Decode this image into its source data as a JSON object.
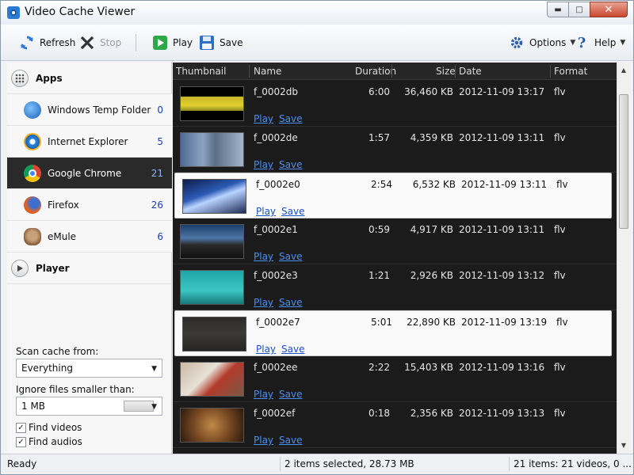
{
  "window": {
    "title": "Video Cache Viewer"
  },
  "toolbar": {
    "refresh_label": "Refresh",
    "stop_label": "Stop",
    "play_label": "Play",
    "save_label": "Save",
    "options_label": "Options",
    "help_label": "Help"
  },
  "sidebar": {
    "apps_heading": "Apps",
    "player_heading": "Player",
    "items": [
      {
        "label": "Windows Temp Folder",
        "count": "0",
        "icon": "windows-logo-icon"
      },
      {
        "label": "Internet Explorer",
        "count": "5",
        "icon": "internet-explorer-icon"
      },
      {
        "label": "Google Chrome",
        "count": "21",
        "icon": "chrome-icon",
        "active": true
      },
      {
        "label": "Firefox",
        "count": "26",
        "icon": "firefox-icon"
      },
      {
        "label": "eMule",
        "count": "6",
        "icon": "emule-icon"
      }
    ],
    "scan_label": "Scan cache from:",
    "scan_value": "Everything",
    "ignore_label": "Ignore files smaller than:",
    "ignore_value": "1 MB",
    "find_videos_label": "Find videos",
    "find_videos_checked": true,
    "find_audios_label": "Find audios",
    "find_audios_checked": true
  },
  "table": {
    "columns": [
      "Thumbnail",
      "Name",
      "Duration",
      "Size",
      "Date",
      "Format"
    ],
    "play_link": "Play",
    "save_link": "Save",
    "rows": [
      {
        "name": "f_0002db",
        "duration": "6:00",
        "size": "36,460 KB",
        "date": "2012-11-09 13:17",
        "format": "flv",
        "selected": false,
        "thumb": "linear-gradient(#000 0%, #000 28%, #c7b328 28%, #e4cf2e 55%, #8a8a22 72%, #000 72%)"
      },
      {
        "name": "f_0002de",
        "duration": "1:57",
        "size": "4,359 KB",
        "date": "2012-11-09 13:11",
        "format": "flv",
        "selected": false,
        "thumb": "linear-gradient(90deg, #4d6a93 0%, #8da3c2 35%, #5b6e86 55%, #a4b5cc 100%)"
      },
      {
        "name": "f_0002e0",
        "duration": "2:54",
        "size": "6,532 KB",
        "date": "2012-11-09 13:11",
        "format": "flv",
        "selected": true,
        "thumb": "linear-gradient(160deg, #0d1b4b 0%, #2c5bb5 40%, #b9d4ff 55%, #1c2a55 100%)"
      },
      {
        "name": "f_0002e1",
        "duration": "0:59",
        "size": "4,917 KB",
        "date": "2012-11-09 13:11",
        "format": "flv",
        "selected": false,
        "thumb": "linear-gradient(#1c3f6c 0%, #4d77a6 40%, #2b2b2b 60%, #111 100%)"
      },
      {
        "name": "f_0002e3",
        "duration": "1:21",
        "size": "2,926 KB",
        "date": "2012-11-09 13:12",
        "format": "flv",
        "selected": false,
        "thumb": "linear-gradient(#1fa5a8 0%, #3cc6c3 60%, #16777a 100%)"
      },
      {
        "name": "f_0002e7",
        "duration": "5:01",
        "size": "22,890 KB",
        "date": "2012-11-09 13:19",
        "format": "flv",
        "selected": true,
        "thumb": "linear-gradient(#2d2d2b 0%, #3b3a36 50%, #252522 100%)"
      },
      {
        "name": "f_0002ee",
        "duration": "2:22",
        "size": "15,403 KB",
        "date": "2012-11-09 13:16",
        "format": "flv",
        "selected": false,
        "thumb": "linear-gradient(135deg, #c9b8a3 0%, #e7e1d7 40%, #b23a2a 60%, #7a5a45 100%)"
      },
      {
        "name": "f_0002ef",
        "duration": "0:18",
        "size": "2,356 KB",
        "date": "2012-11-09 13:13",
        "format": "flv",
        "selected": false,
        "thumb": "radial-gradient(circle at 50% 50%, #c08a4a 0%, #7a4a22 50%, #2a1a10 100%)"
      }
    ]
  },
  "status": {
    "left": "Ready",
    "middle": "2 items selected, 28.73 MB",
    "right": "21 items: 21 videos, 0 ..."
  }
}
